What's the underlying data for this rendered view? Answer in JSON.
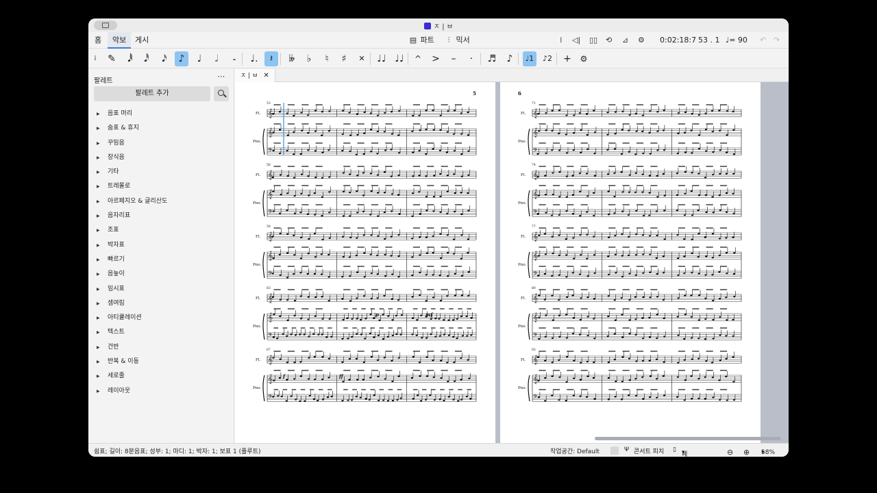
{
  "window": {
    "title": "ㅈ | ㅂ"
  },
  "tabs": [
    {
      "label": "홈"
    },
    {
      "label": "악보"
    },
    {
      "label": "게시"
    }
  ],
  "toolbar": {
    "parts_label": "파트",
    "mixer_label": "믹서",
    "time": "0:02:18:7",
    "position": "53 . 1",
    "tempo": "= 90"
  },
  "palette": {
    "title": "팔레트",
    "more": "···",
    "add_label": "팔레트 추가",
    "items": [
      "음표 머리",
      "숨표 & 휴지",
      "꾸밈음",
      "장식음",
      "기타",
      "트레몰로",
      "아르페지오 & 글리산도",
      "음자리표",
      "조표",
      "박자표",
      "빠르기",
      "음높이",
      "임시표",
      "셈여림",
      "아티큘레이션",
      "텍스트",
      "건반",
      "반복 & 이동",
      "세로줄",
      "레이아웃"
    ]
  },
  "score": {
    "tab_label": "ㅈ | ㅂ",
    "page_left": {
      "number": "5",
      "systems": [
        {
          "measure": "53",
          "fl": "Fl.",
          "pno": "Pno."
        },
        {
          "measure": "56",
          "fl": "Fl.",
          "pno": "Pno."
        },
        {
          "measure": "59",
          "fl": "Fl.",
          "pno": "Pno."
        },
        {
          "measure": "63",
          "fl": "Fl.",
          "pno": "Pno."
        },
        {
          "measure": "67",
          "fl": "Fl.",
          "pno": "Pno."
        }
      ],
      "dynamics": [
        "p",
        "mf",
        "f",
        "ff"
      ]
    },
    "page_right": {
      "number": "6",
      "systems": [
        {
          "measure": "71",
          "fl": "Fl.",
          "pno": "Pno."
        },
        {
          "measure": "74",
          "fl": "Fl.",
          "pno": "Pno."
        },
        {
          "measure": "77",
          "fl": "Fl.",
          "pno": "Pno."
        },
        {
          "measure": "80",
          "fl": "Fl.",
          "pno": "Pno."
        },
        {
          "measure": "83",
          "fl": "Fl.",
          "pno": "Pno."
        }
      ]
    }
  },
  "status": {
    "selection": "쉼표; 길이: 8분음표; 성부: 1; 마디: 1; 박자: 1; 보표 1 (플루트)",
    "workspace": "작업공간: Default",
    "concert_pitch": "콘서트 피치",
    "view_mode": "페이지 보기",
    "zoom": "58%"
  }
}
